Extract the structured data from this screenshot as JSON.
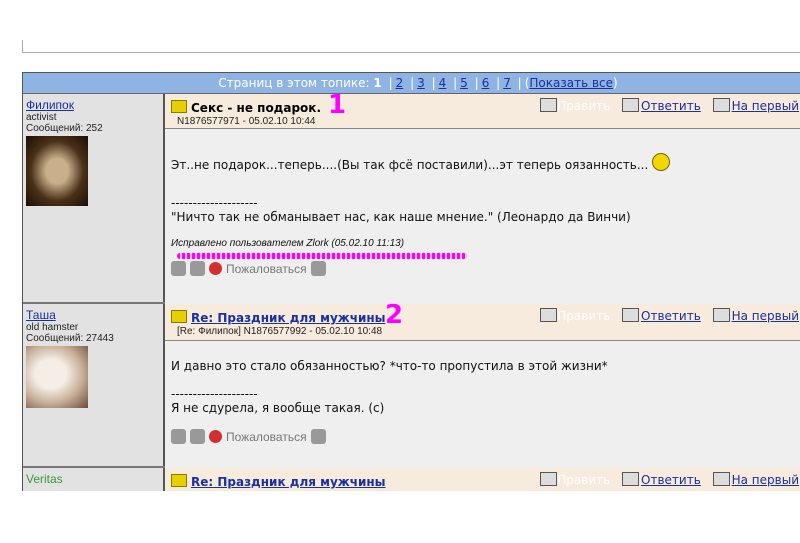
{
  "pager": {
    "label": "Страниц в этом топике:",
    "current": "1",
    "pages": [
      "2",
      "3",
      "4",
      "5",
      "6",
      "7"
    ],
    "show_all": "Показать все"
  },
  "actions": {
    "edit": "Править",
    "reply": "Ответить",
    "to_first": "На первый"
  },
  "posts": [
    {
      "author": "Филипок",
      "rank": "activist",
      "count": "Сообщений: 252",
      "title": "Секс - не подарок.",
      "meta": "N1876577971 - 05.02.10 10:44",
      "lines": [
        "Эт..не подарок...теперь....(Вы так фсё поставили)...эт теперь оязанность..."
      ],
      "sig_sep": "--------------------",
      "sig": "\"Ничто так не обманывает нас, как наше мнение.\" (Леонардо да Винчи)",
      "edited": "Исправлено пользователем Zlork (05.02.10 11:13)",
      "complain": "Пожаловаться",
      "annotation": "1"
    },
    {
      "author": "Таша",
      "rank": "old hamster",
      "count": "Сообщений: 27443",
      "title": "Re: Праздник для мужчины",
      "meta": "[Re: Филипок]  N1876577992 - 05.02.10 10:48",
      "lines": [
        "И давно это стало обязанностью? *что-то пропустила в этой жизни*"
      ],
      "sig_sep": "--------------------",
      "sig": "Я не сдурела, я вообще такая. (с)",
      "complain": "Пожаловаться",
      "annotation": "2"
    },
    {
      "author": "Veritas",
      "title": "Re: Праздник для мужчины"
    }
  ]
}
